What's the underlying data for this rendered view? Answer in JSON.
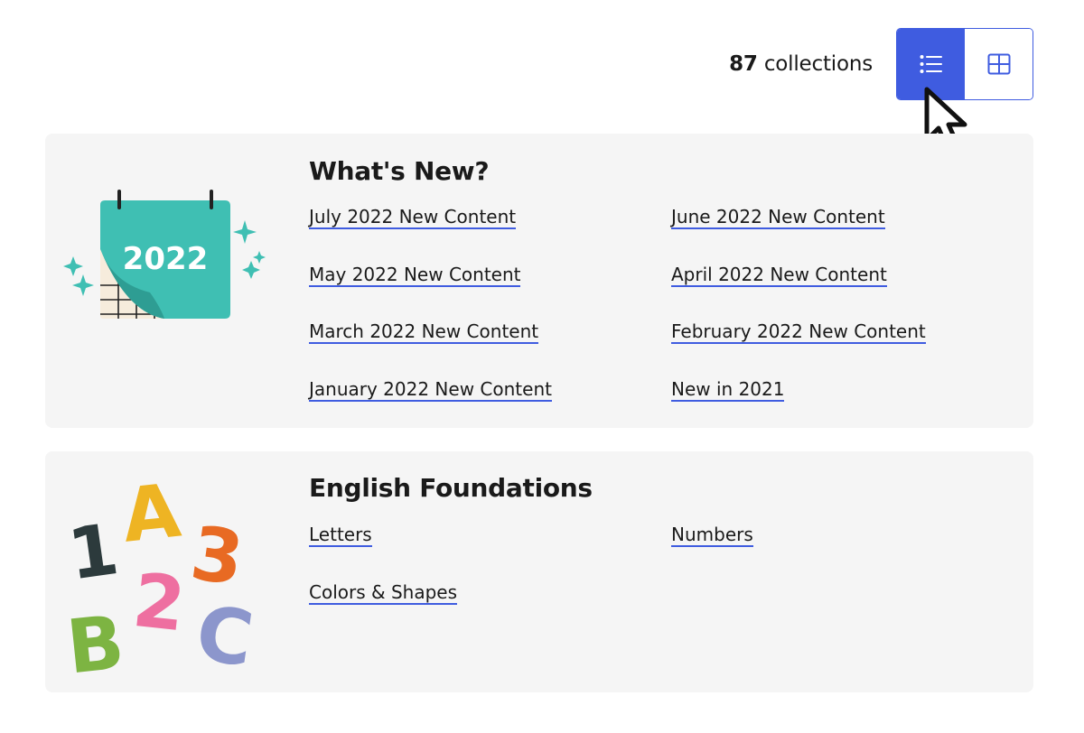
{
  "header": {
    "collection_count": "87",
    "collection_label": "collections",
    "view_toggle": {
      "list_icon": "list-icon",
      "grid_icon": "grid-icon",
      "active": "list"
    }
  },
  "colors": {
    "accent": "#3f5ce0",
    "card_bg": "#f5f5f5",
    "text": "#1a1a1a"
  },
  "collections": [
    {
      "title": "What's New?",
      "illustration": "calendar-2022-icon",
      "illustration_text": "2022",
      "links": [
        "July 2022 New Content",
        "June 2022 New Content",
        "May 2022 New Content",
        "April 2022 New Content",
        "March 2022 New Content",
        "February 2022 New Content",
        "January 2022 New Content",
        "New in 2021"
      ]
    },
    {
      "title": "English Foundations",
      "illustration": "letters-numbers-icon",
      "illustration_glyphs": [
        "1",
        "A",
        "3",
        "2",
        "B",
        "C"
      ],
      "links": [
        "Letters",
        "Numbers",
        "Colors & Shapes"
      ]
    }
  ]
}
